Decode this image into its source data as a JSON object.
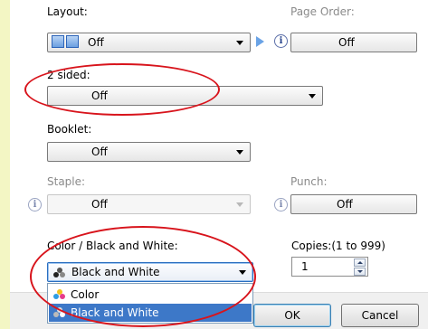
{
  "layout": {
    "label": "Layout:",
    "value": "Off"
  },
  "page_order": {
    "label": "Page Order:",
    "value": "Off"
  },
  "two_sided": {
    "label": "2 sided:",
    "value": "Off"
  },
  "booklet": {
    "label": "Booklet:",
    "value": "Off"
  },
  "staple": {
    "label": "Staple:",
    "value": "Off"
  },
  "punch": {
    "label": "Punch:",
    "value": "Off"
  },
  "color_mode": {
    "label": "Color / Black and White:",
    "value": "Black and White",
    "options": [
      "Color",
      "Black and White"
    ],
    "selected_option": "Black and White"
  },
  "copies": {
    "label": "Copies:(1 to 999)",
    "value": "1"
  },
  "buttons": {
    "ok": "OK",
    "cancel": "Cancel"
  },
  "info_glyph": "i",
  "colors": {
    "background": "#f3f6c4",
    "highlight_ellipse": "#d8141c",
    "selection": "#3d78c8"
  }
}
